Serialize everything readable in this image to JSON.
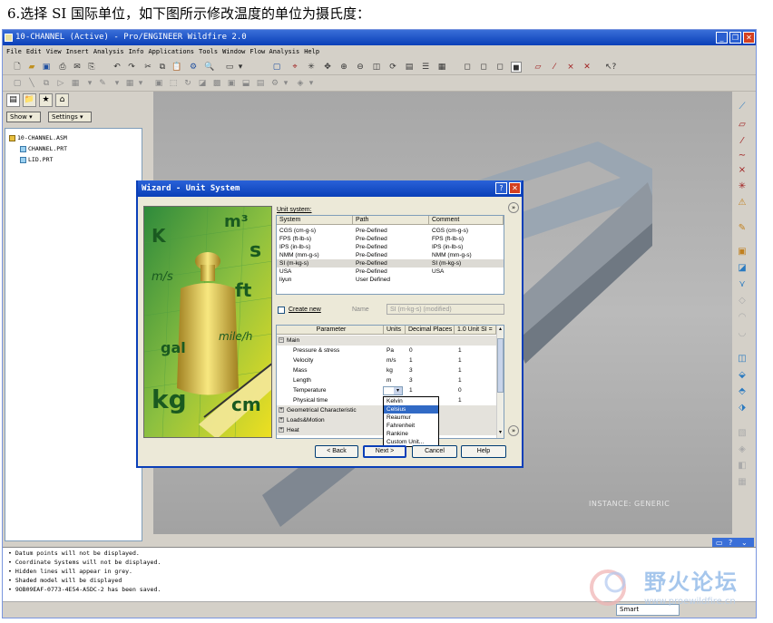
{
  "caption": "6.选择 SI 国际单位，如下图所示修改温度的单位为摄氏度：",
  "app": {
    "title": "10-CHANNEL (Active) - Pro/ENGINEER Wildfire 2.0",
    "menu": [
      "File",
      "Edit",
      "View",
      "Insert",
      "Analysis",
      "Info",
      "Applications",
      "Tools",
      "Window",
      "Flow Analysis",
      "Help"
    ],
    "left_panel": {
      "show_label": "Show",
      "settings_label": "Settings",
      "tree": [
        "10-CHANNEL.ASM",
        "CHANNEL.PRT",
        "LID.PRT"
      ]
    },
    "graphics": {
      "instance_label": "INSTANCE: GENERIC"
    },
    "messages": [
      "Datum points will not be displayed.",
      "Coordinate Systems will not be displayed.",
      "Hidden lines will appear in grey.",
      "Shaded model will be displayed",
      "9OB09EAF-0773-4E54-A5DC-2 has been saved."
    ],
    "status": {
      "filter": "Smart"
    }
  },
  "dialog": {
    "title": "Wizard - Unit System",
    "image_words": [
      "K",
      "m³",
      "s",
      "m/s",
      "ft",
      "mile/h",
      "gal",
      "kg",
      "cm"
    ],
    "unit_system_label": "Unit system:",
    "unit_columns": [
      "System",
      "Path",
      "Comment"
    ],
    "unit_rows": [
      {
        "system": "CGS (cm-g-s)",
        "path": "Pre-Defined",
        "comment": "CGS (cm-g-s)"
      },
      {
        "system": "FPS (ft-lb-s)",
        "path": "Pre-Defined",
        "comment": "FPS (ft-lb-s)"
      },
      {
        "system": "IPS (in-lb-s)",
        "path": "Pre-Defined",
        "comment": "IPS (in-lb-s)"
      },
      {
        "system": "NMM (mm-g-s)",
        "path": "Pre-Defined",
        "comment": "NMM (mm-g-s)"
      },
      {
        "system": "SI (m-kg-s)",
        "path": "Pre-Defined",
        "comment": "SI (m-kg-s)"
      },
      {
        "system": "USA",
        "path": "Pre-Defined",
        "comment": "USA"
      },
      {
        "system": "liyun",
        "path": "User Defined",
        "comment": ""
      }
    ],
    "selected_unit_row": 4,
    "create_new_label": "Create new",
    "name_label": "Name",
    "name_value": "SI (m-kg-s) (modified)",
    "param_columns": [
      "Parameter",
      "Units",
      "Decimal Places",
      "1.0 Unit SI ="
    ],
    "param_rows": [
      {
        "type": "group",
        "name": "Main",
        "units": "",
        "decimals": "",
        "si": ""
      },
      {
        "type": "item",
        "name": "Pressure & stress",
        "units": "Pa",
        "decimals": "0",
        "si": "1"
      },
      {
        "type": "item",
        "name": "Velocity",
        "units": "m/s",
        "decimals": "1",
        "si": "1"
      },
      {
        "type": "item",
        "name": "Mass",
        "units": "kg",
        "decimals": "3",
        "si": "1"
      },
      {
        "type": "item",
        "name": "Length",
        "units": "m",
        "decimals": "3",
        "si": "1"
      },
      {
        "type": "item",
        "name": "Temperature",
        "units": "",
        "decimals": "1",
        "si": "0"
      },
      {
        "type": "item",
        "name": "Physical time",
        "units": "",
        "decimals": "",
        "si": "1"
      },
      {
        "type": "group",
        "name": "Geometrical Characteristic",
        "units": "",
        "decimals": "",
        "si": ""
      },
      {
        "type": "group",
        "name": "Loads&Motion",
        "units": "",
        "decimals": "",
        "si": ""
      },
      {
        "type": "group",
        "name": "Heat",
        "units": "",
        "decimals": "",
        "si": ""
      }
    ],
    "temperature_options": [
      "Kelvin",
      "Celsius",
      "Reaumur",
      "Fahrenheit",
      "Rankine",
      "Custom Unit..."
    ],
    "temperature_selected": 1,
    "buttons": {
      "back": "< Back",
      "next": "Next >",
      "cancel": "Cancel",
      "help": "Help"
    }
  },
  "watermark": {
    "text": "野火论坛",
    "url": "www.proewildfire.cn"
  },
  "colors": {
    "title_bar": "#0a3fb8",
    "selection": "#316ac5",
    "graphics_bg": "#a7a7a7"
  }
}
